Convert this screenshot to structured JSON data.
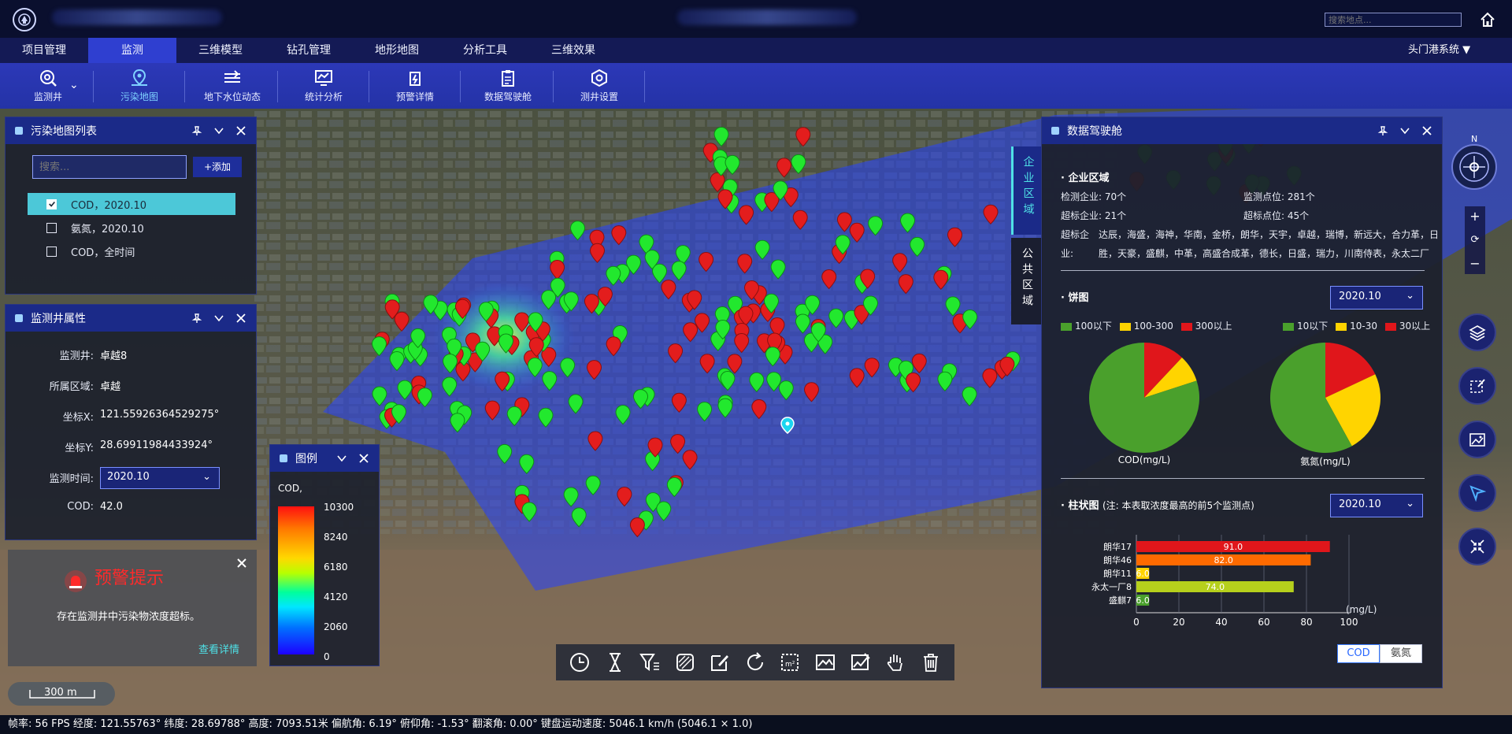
{
  "app": {
    "search_placeholder": "搜索地点..."
  },
  "menu": {
    "items": [
      {
        "label": "项目管理"
      },
      {
        "label": "监测"
      },
      {
        "label": "三维模型"
      },
      {
        "label": "钻孔管理"
      },
      {
        "label": "地形地图"
      },
      {
        "label": "分析工具"
      },
      {
        "label": "三维效果"
      }
    ],
    "active_index": 1,
    "system": "头门港系统"
  },
  "toolbar": {
    "items": [
      {
        "label": "监测井",
        "icon": "search-icon"
      },
      {
        "label": "污染地图",
        "icon": "map-pin-icon"
      },
      {
        "label": "地下水位动态",
        "icon": "water-level-icon"
      },
      {
        "label": "统计分析",
        "icon": "monitor-chart-icon"
      },
      {
        "label": "预警详情",
        "icon": "alert-icon"
      },
      {
        "label": "数据驾驶舱",
        "icon": "clipboard-icon"
      },
      {
        "label": "测井设置",
        "icon": "hexagon-icon"
      }
    ]
  },
  "pollution_list": {
    "title": "污染地图列表",
    "search_placeholder": "搜索...",
    "add_label": "+添加",
    "items": [
      {
        "label": "COD，2020.10",
        "checked": true
      },
      {
        "label": "氨氮，2020.10",
        "checked": false
      },
      {
        "label": "COD，全时间",
        "checked": false
      }
    ]
  },
  "well_props": {
    "title": "监测井属性",
    "rows": [
      {
        "label": "监测井:",
        "value": "卓越8"
      },
      {
        "label": "所属区域:",
        "value": "卓越"
      },
      {
        "label": "坐标X:",
        "value": "121.55926364529275°"
      },
      {
        "label": "坐标Y:",
        "value": "28.69911984433924°"
      },
      {
        "label": "监测时间:",
        "value": "2020.10"
      },
      {
        "label": "COD:",
        "value": "42.0"
      }
    ]
  },
  "alert": {
    "title": "预警提示",
    "text": "存在监测井中污染物浓度超标。",
    "link": "查看详情"
  },
  "scale": {
    "label": "300 m"
  },
  "legend": {
    "title": "图例",
    "name": "COD,",
    "ticks": [
      "10300",
      "8240",
      "6180",
      "4120",
      "2060",
      "0"
    ]
  },
  "status": {
    "text": "帧率: 56 FPS 经度: 121.55763° 纬度: 28.69788° 高度: 7093.51米 偏航角: 6.19° 俯仰角: -1.53° 翻滚角: 0.00° 键盘运动速度: 5046.1 km/h (5046.1 × 1.0)"
  },
  "cockpit": {
    "title": "数据驾驶舱",
    "tabs": [
      "企业区域",
      "公共区域"
    ],
    "enterprise": {
      "title": "· 企业区域",
      "detect_enterprise": "检测企业: 70个",
      "monitor_points": "监测点位: 281个",
      "over_enterprise": "超标企业: 21个",
      "over_points": "超标点位: 45个",
      "over_list_label_1": "超标企",
      "over_list_label_2": "业:",
      "over_list_1": "达辰，海盛，海神，华南，金桥，朗华，天宇，卓越，瑞博，新远大，合力革，日",
      "over_list_2": "胜，天豪，盛麒，中革，高盛合成革，德长，日盛，瑞力，川南侍表，永太二厂"
    },
    "pie": {
      "title": "· 饼图",
      "select": "2020.10",
      "cod_legend": [
        {
          "label": "100以下",
          "color": "#4aa02c"
        },
        {
          "label": "100-300",
          "color": "#ffd400"
        },
        {
          "label": "300以上",
          "color": "#e0161b"
        }
      ],
      "ammonia_legend": [
        {
          "label": "10以下",
          "color": "#4aa02c"
        },
        {
          "label": "10-30",
          "color": "#ffd400"
        },
        {
          "label": "30以上",
          "color": "#e0161b"
        }
      ],
      "cod_caption": "COD(mg/L)",
      "ammonia_caption": "氨氮(mg/L)"
    },
    "bar": {
      "title": "· 柱状图",
      "note": "(注: 本表取浓度最高的前5个监测点)",
      "select": "2020.10",
      "unit": "(mg/L)",
      "toggle_cod": "COD",
      "toggle_ammonia": "氨氮"
    }
  },
  "chart_data": [
    {
      "type": "pie",
      "title": "",
      "caption": "COD(mg/L)",
      "categories": [
        "100以下",
        "100-300",
        "300以上"
      ],
      "values": [
        80,
        8,
        12
      ],
      "colors": [
        "#4aa02c",
        "#ffd400",
        "#e0161b"
      ]
    },
    {
      "type": "pie",
      "title": "",
      "caption": "氨氮(mg/L)",
      "categories": [
        "10以下",
        "10-30",
        "30以上"
      ],
      "values": [
        58,
        24,
        18
      ],
      "colors": [
        "#4aa02c",
        "#ffd400",
        "#e0161b"
      ]
    },
    {
      "type": "bar",
      "orientation": "horizontal",
      "categories": [
        "朗华17",
        "朗华46",
        "朗华11",
        "永太一厂8",
        "盛麒7"
      ],
      "values": [
        91.0,
        82.0,
        6.0,
        74.0,
        6.0
      ],
      "value_labels": [
        "91.0",
        "82.0",
        "6.0",
        "74.0",
        "6.0"
      ],
      "colors": [
        "#e0161b",
        "#ff6a00",
        "#ffd400",
        "#b6d01c",
        "#4aa02c"
      ],
      "xlim": [
        0,
        100
      ],
      "xticks": [
        "0",
        "20",
        "40",
        "60",
        "80",
        "100"
      ],
      "xlabel": "(mg/L)"
    }
  ]
}
